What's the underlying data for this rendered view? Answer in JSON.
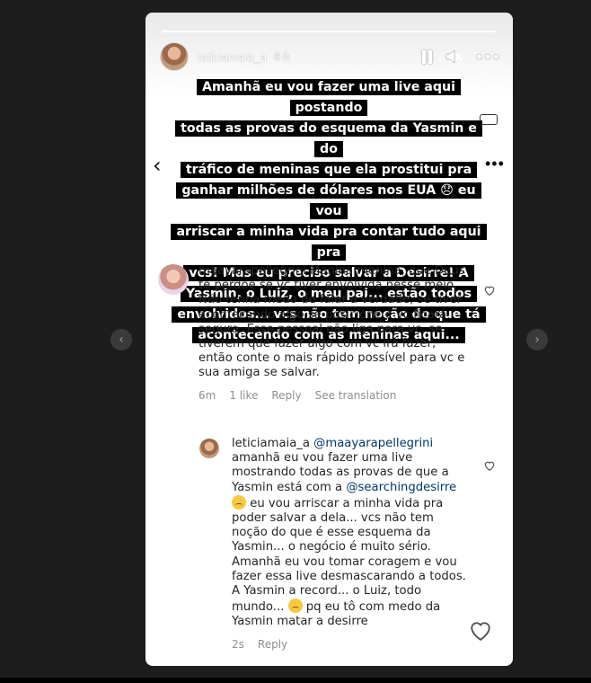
{
  "story": {
    "username": "leticiamaia_a",
    "time": "6 h",
    "caption_lines": [
      "Amanhã eu vou fazer uma live aqui postando",
      "todas as provas do esquema da Yasmin e do",
      "tráfico de meninas que ela prostitui pra",
      "ganhar milhões de dólares nos EUA 😞 eu vou",
      "arriscar a minha vida pra contar tudo aqui pra",
      "vcs!  Mas eu preciso salvar a Desirre! A",
      "Yasmin, o Luiz, o meu pai... estão todos",
      "envolvidos... vcs não tem noção do que tá",
      "acontecendo com as meninas aqui..."
    ]
  },
  "comments": [
    {
      "username": "maayarapellegrini",
      "text": "Menina menina, que Deus te perdoe se vc tiver envolvida nesse meio. Não tenha medo de falar a verdade, se tiver acontecendo algo se posicione e vc ficará segura. Esse pessoal não liga para vc, se tiverem que fazer algo com vc irá fazer, então conte o mais rápido possível para vc e sua amiga se salvar.",
      "age": "6m",
      "likes": "1 like",
      "reply": "Reply",
      "translate": "See translation"
    },
    {
      "username": "leticiamaia_a",
      "mention1": "@maayarapellegrini",
      "text1": "amanhã eu vou fazer uma live mostrando todas as provas de que a Yasmin está com a",
      "mention2": "@searchingdesirre",
      "text2": "eu vou arriscar a minha vida pra poder salvar a dela... vcs não tem noção do que é esse esquema da Yasmin... o negócio é muito sério. Amanhã eu vou tomar coragem e vou fazer essa live desmascarando a todos. A Yasmin a record... o Luiz, todo mundo...",
      "text3": "pq eu tô com medo da Yasmin matar a desirre",
      "age": "2s",
      "reply": "Reply"
    }
  ],
  "icons": {
    "pause": "pause-icon",
    "mute": "mute-icon",
    "more": "more-icon",
    "heart": "heart-icon"
  }
}
